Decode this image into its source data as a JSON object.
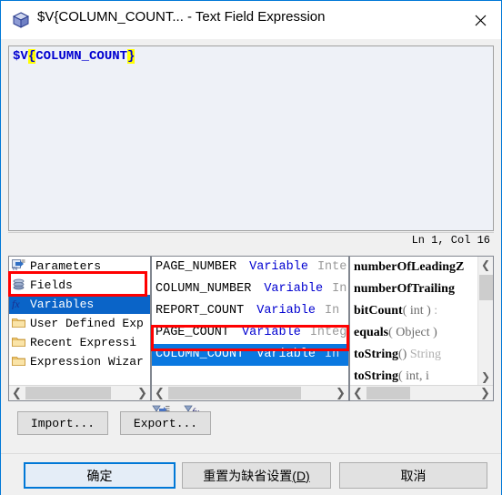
{
  "window": {
    "title": "$V{COLUMN_COUNT... - Text Field Expression",
    "icon": "cube-icon",
    "close_label": "×",
    "accent_color": "#0078d7",
    "selection_color": "#0a64c8",
    "annotation_color": "#ff0000"
  },
  "expression": {
    "prefix": "$V",
    "open_brace": "{",
    "variable": "COLUMN_COUNT",
    "close_brace": "}",
    "full_text": "$V{COLUMN_COUNT}",
    "text_color": "#0000d0",
    "highlight_color": "#ffff00",
    "status": "Ln 1, Col 16"
  },
  "categories": {
    "items": [
      {
        "label": "Parameters",
        "icon": "parameters-icon",
        "selected": false
      },
      {
        "label": "Fields",
        "icon": "fields-icon",
        "selected": false
      },
      {
        "label": "Variables",
        "icon": "function-icon",
        "selected": true
      },
      {
        "label": "User Defined Exp",
        "icon": "folder-icon",
        "selected": false
      },
      {
        "label": "Recent Expressi",
        "icon": "folder-icon",
        "selected": false
      },
      {
        "label": "Expression Wizar",
        "icon": "folder-icon",
        "selected": false
      }
    ]
  },
  "objects": {
    "items": [
      {
        "name": "PAGE_NUMBER",
        "kind": "Variable",
        "type": "Inte",
        "selected": false
      },
      {
        "name": "COLUMN_NUMBER",
        "kind": "Variable",
        "type": "In",
        "selected": false
      },
      {
        "name": "REPORT_COUNT",
        "kind": "Variable",
        "type": "In",
        "selected": false
      },
      {
        "name": "PAGE_COUNT",
        "kind": "Variable",
        "type": "Integ",
        "selected": false
      },
      {
        "name": "COLUMN_COUNT",
        "kind": "Variable",
        "type": "In",
        "selected": true
      }
    ],
    "toolbar": [
      {
        "icon": "filter-list-icon"
      },
      {
        "icon": "filter-function-icon"
      }
    ]
  },
  "members": {
    "items": [
      {
        "name": "numberOfLeadingZ",
        "args": "",
        "ret": ""
      },
      {
        "name": "numberOfTrailing",
        "args": "",
        "ret": ""
      },
      {
        "name": "bitCount",
        "args": "( int )",
        "ret": ":"
      },
      {
        "name": "equals",
        "args": "( Object )",
        "ret": ""
      },
      {
        "name": "toString",
        "args": "()",
        "ret": "String"
      },
      {
        "name": "toString",
        "args": "( int, i",
        "ret": ""
      }
    ]
  },
  "actions": {
    "import_label": "Import...",
    "export_label": "Export..."
  },
  "footer": {
    "ok_label": "确定",
    "reset_label": "重置为缺省设置",
    "reset_mnemonic": "(D)",
    "cancel_label": "取消"
  }
}
